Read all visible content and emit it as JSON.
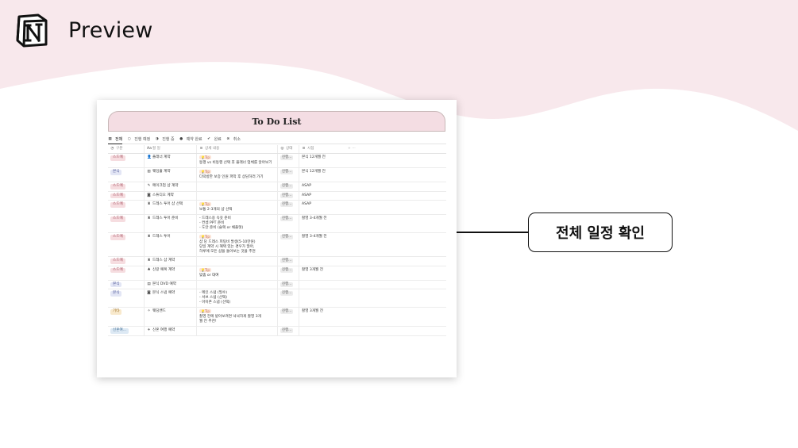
{
  "brand": {
    "title": "Preview"
  },
  "notion": {
    "page_title": "To Do List",
    "views": [
      {
        "label": "전체",
        "icon": "table-icon",
        "active": true
      },
      {
        "label": "진행 예정",
        "icon": "empty-circle-icon"
      },
      {
        "label": "진행 중",
        "icon": "half-circle-icon"
      },
      {
        "label": "예약 완료",
        "icon": "dark-circle-icon"
      },
      {
        "label": "완료",
        "icon": "check-circle-icon"
      },
      {
        "label": "취소",
        "icon": "x-circle-icon"
      }
    ],
    "columns": {
      "category": "구분",
      "name": "할 일",
      "detail": "상세 내용",
      "status": "상태",
      "time": "시점",
      "add": "+   ···"
    },
    "rows": [
      {
        "category": "스드메",
        "name": "플래너 계약",
        "name_icon": "person-icon",
        "tip": "Tip",
        "detail": [
          "동행 vs 비동행 선택 후 플래너 업체를 알아보기"
        ],
        "status": "진행...",
        "time": "본식 12개월 전"
      },
      {
        "category": "본식",
        "name": "웨딩홀 계약",
        "name_icon": "building-icon",
        "tip": "Tip",
        "detail": [
          "다락방한 보증 인원 파악 후 상담하러 가기"
        ],
        "status": "진행...",
        "time": "본식 12개월 전"
      },
      {
        "category": "스드메",
        "name": "메이크업 샵 계약",
        "name_icon": "brush-icon",
        "tip": "",
        "detail": [],
        "status": "진행...",
        "time": "ASAP"
      },
      {
        "category": "스드메",
        "name": "스튜디오 계약",
        "name_icon": "camera-icon",
        "tip": "",
        "detail": [],
        "status": "진행...",
        "time": "ASAP"
      },
      {
        "category": "스드메",
        "name": "드레스 투어 샵 선택",
        "name_icon": "dress-icon",
        "tip": "Tip",
        "detail": [
          "보통 2-3개의 샵 선택"
        ],
        "status": "진행...",
        "time": "ASAP"
      },
      {
        "category": "스드메",
        "name": "드레스 투어 준비",
        "name_icon": "dress-icon",
        "tip": "",
        "detail": [
          "- 드레스용 속옷 준비",
          "- 컨셉 PPT 준비",
          "- 도안 준비 (슬랙 or 채플렛)"
        ],
        "status": "진행...",
        "time": "촬영 3-4개월 전"
      },
      {
        "category": "스드메",
        "name": "드레스 투어",
        "name_icon": "dress-icon",
        "tip": "Tip",
        "detail": [
          "샵 당 드레스 피팅비 발생(5-10만원)",
          "당일 계약 시 혜택 있는 경우가 많아,",
          "하루에 모든 샵을 돌아보는 것을 추천"
        ],
        "status": "진행...",
        "time": "촬영 3-4개월 전"
      },
      {
        "category": "스드메",
        "name": "드레스 샵 계약",
        "name_icon": "dress-icon",
        "tip": "",
        "detail": [],
        "status": "진행...",
        "time": ""
      },
      {
        "category": "스드메",
        "name": "신랑 예복 계약",
        "name_icon": "suit-icon",
        "tip": "Tip",
        "detail": [
          "맞춤 or 대여"
        ],
        "status": "진행...",
        "time": "촬영 3개월 전"
      },
      {
        "category": "본식",
        "name": "본식 DVD 예약",
        "name_icon": "film-icon",
        "tip": "",
        "detail": [],
        "status": "진행...",
        "time": ""
      },
      {
        "category": "본식",
        "name": "본식 스냅 예약",
        "name_icon": "camera-icon",
        "tip": "",
        "detail": [
          "- 메인 스냅 (필수)",
          "- 서브 스냅 (선택)",
          "- 아이폰 스냅 (선택)"
        ],
        "status": "진행...",
        "time": ""
      },
      {
        "category": "기타",
        "name": "웨딩밴드",
        "name_icon": "sparkle-icon",
        "tip": "Tip",
        "detail": [
          "촬영 전에 받아보려면 넉넉하게 촬영 3개",
          "월 전 추천!"
        ],
        "status": "진행...",
        "time": "촬영 3개월 전"
      },
      {
        "category": "신혼여...",
        "name": "신혼 여행 예약",
        "name_icon": "plane-icon",
        "tip": "",
        "detail": [],
        "status": "진행...",
        "time": ""
      }
    ]
  },
  "category_colors": {
    "스드메": {
      "bg": "#f6dde0",
      "fg": "#a24a5a"
    },
    "본식": {
      "bg": "#e3e6f5",
      "fg": "#4c5596"
    },
    "기타": {
      "bg": "#f8e9cc",
      "fg": "#9a6b20"
    },
    "신혼여...": {
      "bg": "#dde9f4",
      "fg": "#3c6a92"
    }
  },
  "callout": {
    "text": "전체 일정 확인"
  }
}
